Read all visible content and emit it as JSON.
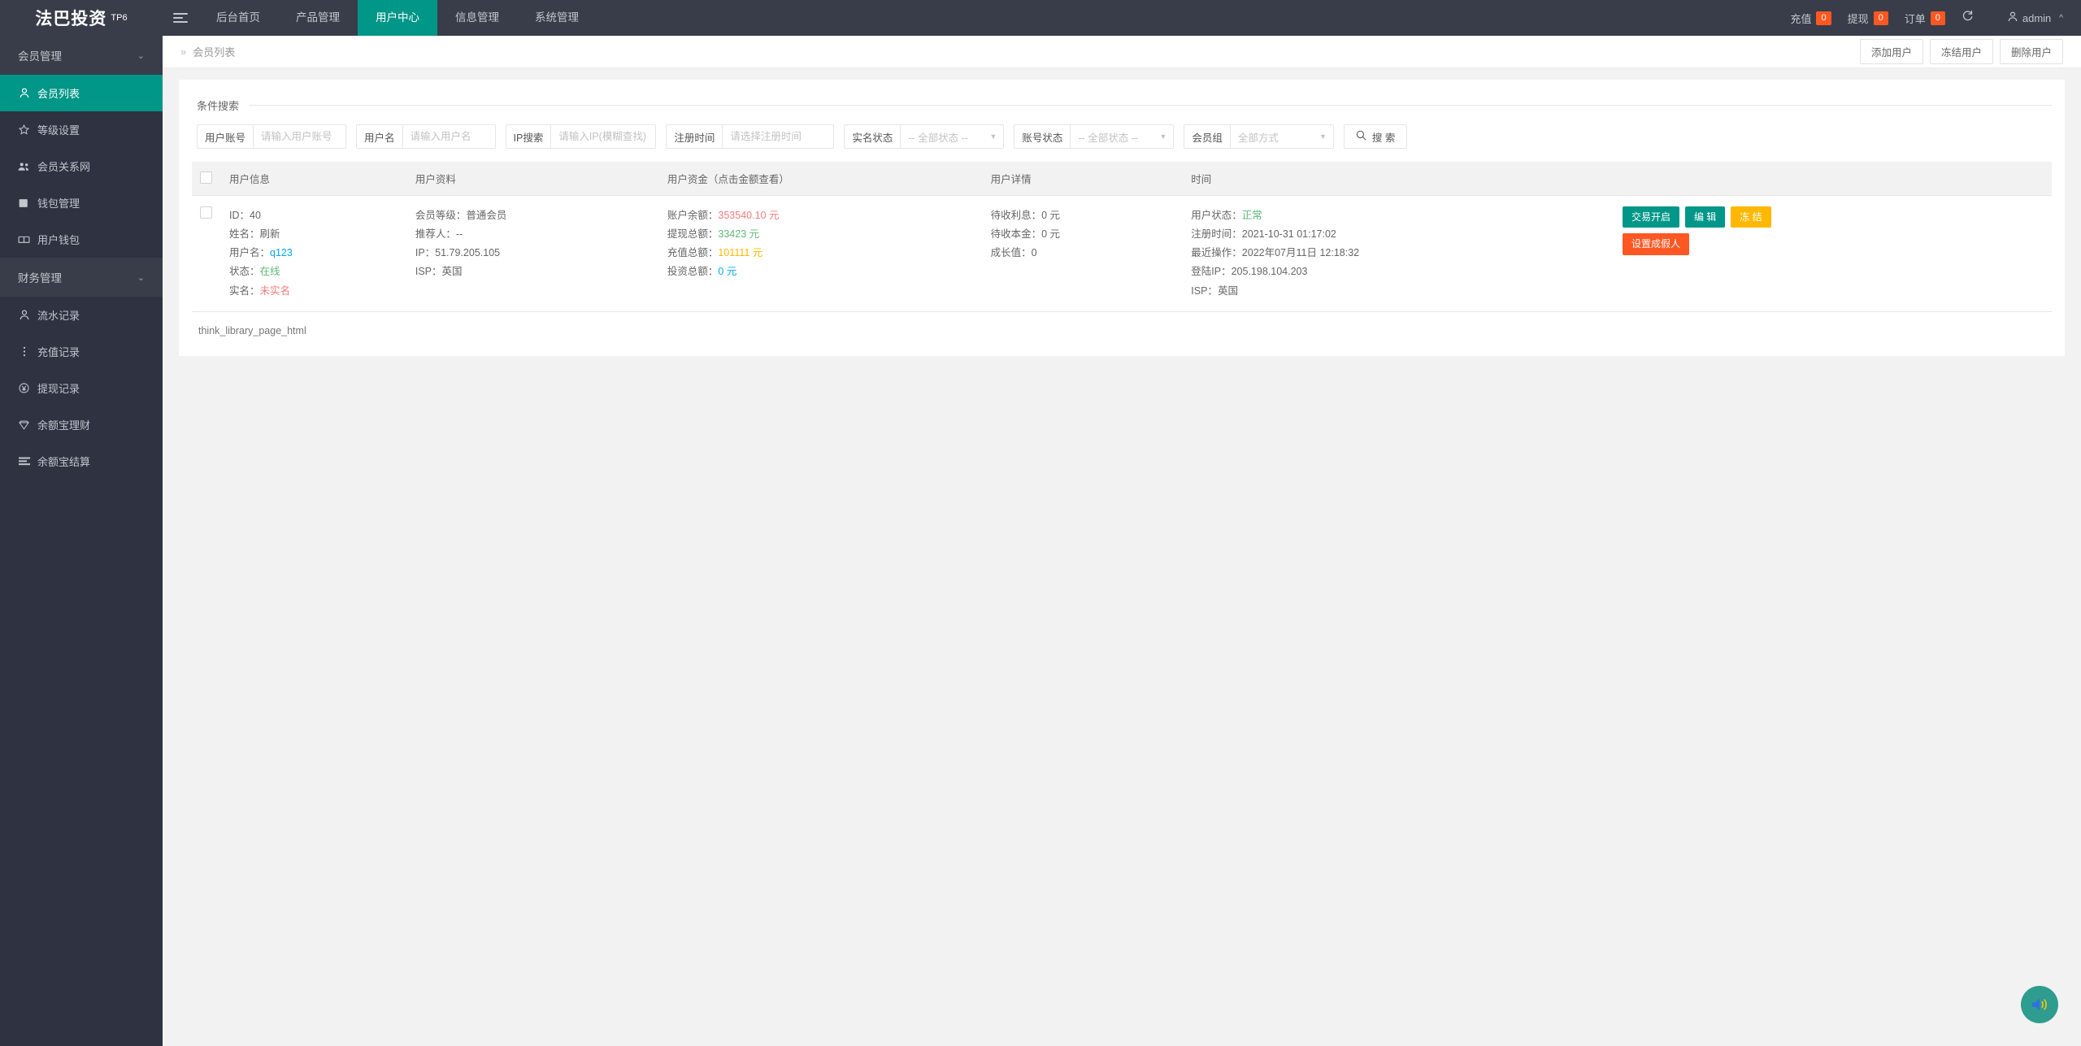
{
  "topbar": {
    "logo": "法巴投资",
    "logo_sup": "TP6",
    "menu_icon": "hamburger-icon",
    "nav": [
      {
        "label": "后台首页",
        "active": false
      },
      {
        "label": "产品管理",
        "active": false
      },
      {
        "label": "用户中心",
        "active": true
      },
      {
        "label": "信息管理",
        "active": false
      },
      {
        "label": "系统管理",
        "active": false
      }
    ],
    "stats": [
      {
        "label": "充值",
        "count": "0"
      },
      {
        "label": "提现",
        "count": "0"
      },
      {
        "label": "订单",
        "count": "0"
      }
    ],
    "refresh_icon": "⟳",
    "user": "admin",
    "badge_color": "#FF5722",
    "accent_color": "#009688"
  },
  "sidebar": {
    "groups": [
      {
        "title": "会员管理",
        "items": [
          {
            "label": "会员列表",
            "icon": "user-icon",
            "glyph": "⚇",
            "active": true
          },
          {
            "label": "等级设置",
            "icon": "star-icon",
            "glyph": "☆",
            "active": false
          },
          {
            "label": "会员关系网",
            "icon": "users-icon",
            "glyph": "⚌",
            "active": false
          },
          {
            "label": "钱包管理",
            "icon": "wallet-icon",
            "glyph": "▤",
            "active": false
          },
          {
            "label": "用户钱包",
            "icon": "book-icon",
            "glyph": "▥",
            "active": false
          }
        ]
      },
      {
        "title": "财务管理",
        "items": [
          {
            "label": "流水记录",
            "icon": "user-icon",
            "glyph": "⚇",
            "active": false
          },
          {
            "label": "充值记录",
            "icon": "dots-icon",
            "glyph": "⋮",
            "active": false
          },
          {
            "label": "提现记录",
            "icon": "yuan-circle-icon",
            "glyph": "¥",
            "active": false
          },
          {
            "label": "余额宝理财",
            "icon": "diamond-icon",
            "glyph": "♢",
            "active": false
          },
          {
            "label": "余额宝结算",
            "icon": "list-icon",
            "glyph": "≡",
            "active": false
          }
        ]
      }
    ]
  },
  "breadcrumb": {
    "arrow": "»",
    "current": "会员列表",
    "actions": [
      {
        "label": "添加用户"
      },
      {
        "label": "冻结用户"
      },
      {
        "label": "删除用户"
      }
    ]
  },
  "search": {
    "title": "条件搜索",
    "fields": [
      {
        "label": "用户账号",
        "placeholder": "请输入用户账号",
        "value": "",
        "type": "text",
        "width": "w-acct"
      },
      {
        "label": "用户名",
        "placeholder": "请输入用户名",
        "value": "",
        "type": "text",
        "width": "w-user"
      },
      {
        "label": "IP搜索",
        "placeholder": "请输入IP(模糊查找)",
        "value": "",
        "type": "text",
        "width": "w-ip"
      },
      {
        "label": "注册时间",
        "placeholder": "请选择注册时间",
        "value": "",
        "type": "date",
        "width": "w-date"
      }
    ],
    "selects": [
      {
        "label": "实名状态",
        "value": "-- 全部状态 --"
      },
      {
        "label": "账号状态",
        "value": "-- 全部状态 --"
      },
      {
        "label": "会员组",
        "value": "全部方式"
      }
    ],
    "search_button": "搜 索",
    "search_icon": "search-icon"
  },
  "table": {
    "headers": [
      "用户信息",
      "用户资料",
      "用户资金（点击金额查看）",
      "用户详情",
      "时间",
      ""
    ],
    "rows": [
      {
        "user_info": [
          {
            "label": "ID：",
            "value": "40",
            "color": "default"
          },
          {
            "label": "姓名：",
            "value": "刷新",
            "color": "default"
          },
          {
            "label": "用户名：",
            "value": "q123",
            "color": "blue"
          },
          {
            "label": "状态：",
            "value": "在线",
            "color": "green"
          },
          {
            "label": "实名：",
            "value": "未实名",
            "color": "pink"
          }
        ],
        "profile": [
          {
            "label": "会员等级：",
            "value": "普通会员",
            "color": "default"
          },
          {
            "label": "推荐人：",
            "value": "--",
            "color": "default"
          },
          {
            "label": "IP：",
            "value": "51.79.205.105",
            "color": "default"
          },
          {
            "label": "ISP：",
            "value": "英国",
            "color": "default"
          }
        ],
        "funds": [
          {
            "label": "账户余额：",
            "value": "353540.10 元",
            "color": "pink"
          },
          {
            "label": "提现总额：",
            "value": "33423 元",
            "color": "green"
          },
          {
            "label": "充值总额：",
            "value": "101111 元",
            "color": "orange"
          },
          {
            "label": "投资总额：",
            "value": "0 元",
            "color": "blue"
          }
        ],
        "details": [
          {
            "label": "待收利息：",
            "value": "0 元",
            "color": "default"
          },
          {
            "label": "待收本金：",
            "value": "0 元",
            "color": "default"
          },
          {
            "label": "成长值：",
            "value": "0",
            "color": "default"
          }
        ],
        "time": [
          {
            "label": "用户状态：",
            "value": "正常",
            "color": "green"
          },
          {
            "label": "注册时间：",
            "value": "2021-10-31 01:17:02",
            "color": "default"
          },
          {
            "label": "最近操作：",
            "value": "2022年07月11日 12:18:32",
            "color": "default"
          },
          {
            "label": "登陆IP：",
            "value": "205.198.104.203",
            "color": "default"
          },
          {
            "label": "ISP：",
            "value": "英国",
            "color": "default"
          }
        ],
        "actions": [
          {
            "label": "交易开启",
            "style": "btn-teal"
          },
          {
            "label": "编 辑",
            "style": "btn-teal"
          },
          {
            "label": "冻 结",
            "style": "btn-amber"
          },
          {
            "label": "设置成假人",
            "style": "btn-orange"
          }
        ]
      }
    ]
  },
  "footer": {
    "text": "think_library_page_html"
  },
  "fab": {
    "icon": "sound-volume-icon"
  }
}
